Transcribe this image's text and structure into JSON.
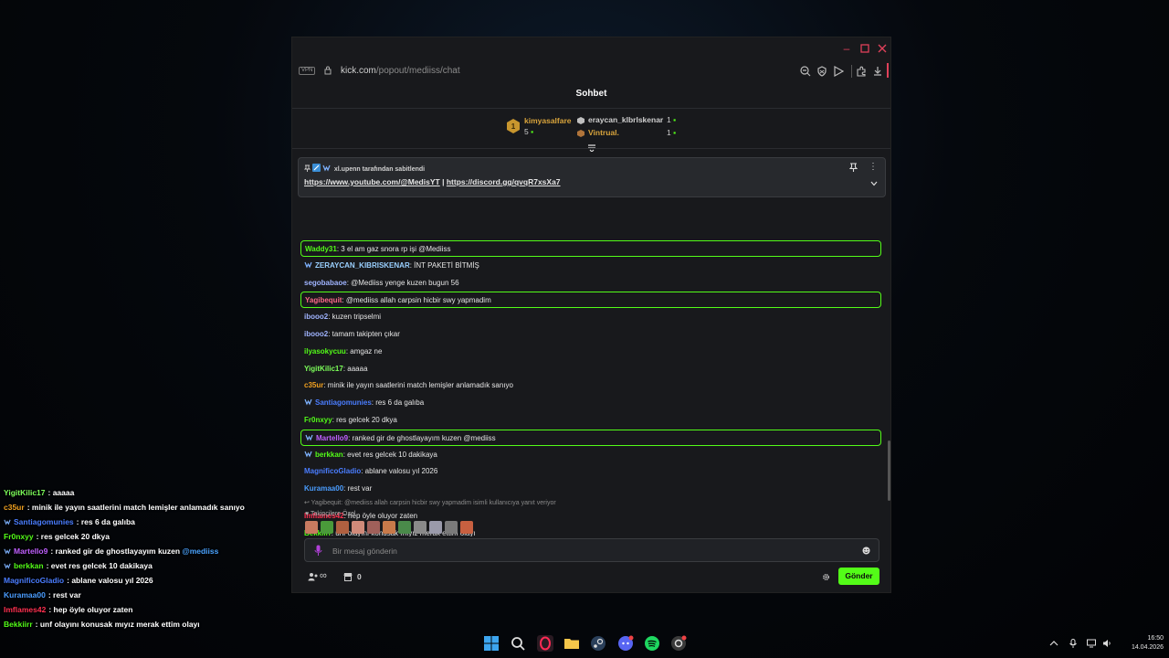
{
  "overlay": {
    "lines": [
      {
        "user": "YigitKilic17",
        "user_color": "#7dff5a",
        "badge": false,
        "text": ": aaaaa"
      },
      {
        "user": "c35ur",
        "user_color": "#f0a020",
        "badge": false,
        "text": ": minik ile yayın saatlerini match lemişler anlamadık sanıyo"
      },
      {
        "user": "Santiagomunies",
        "user_color": "#4a7dff",
        "badge": true,
        "text": ": res 6 da galıba"
      },
      {
        "user": "Fr0nxyy",
        "user_color": "#53fc18",
        "badge": false,
        "text": ": res gelcek 20 dkya"
      },
      {
        "user": "Martello9",
        "user_color": "#c060ff",
        "badge": true,
        "text": ": ranked gir de ghostlayayım kuzen ",
        "mention": "@mediiss"
      },
      {
        "user": "berkkan",
        "user_color": "#53fc18",
        "badge": true,
        "text": ": evet res gelcek 10 dakikaya"
      },
      {
        "user": "MagnificoGladio",
        "user_color": "#4a7dff",
        "badge": false,
        "text": ": ablane valosu yıl 2026"
      },
      {
        "user": "Kuramaa00",
        "user_color": "#4a9dff",
        "badge": false,
        "text": ": rest var"
      },
      {
        "user": "Imflames42",
        "user_color": "#ff3050",
        "badge": false,
        "text": ": hep öyle oluyor zaten"
      },
      {
        "user": "Bekkiirr",
        "user_color": "#53fc18",
        "badge": false,
        "text": ": unf olayını konusak mıyız merak ettim olayı"
      }
    ]
  },
  "browser": {
    "vpn_label": "VPN",
    "url_domain": "kick.com",
    "url_path": "/popout/mediiss/chat"
  },
  "chat": {
    "title": "Sohbet",
    "leaderboard": {
      "first": {
        "user": "kimyasalfare",
        "count": "5",
        "rank": "1"
      },
      "second": {
        "user": "eraycan_klbrlskenar",
        "count": "1"
      },
      "third": {
        "user": "Vintrual.",
        "count": "1"
      }
    },
    "pinned": {
      "header": "xl.upenn tarafından sabitlendi",
      "link1": "https://www.youtube.com/@MedisYT",
      "separator": "|",
      "link2": "https://discord.gg/qvqR7xsXa7"
    },
    "messages": [
      {
        "user": "Waddy31",
        "color": "#53fc18",
        "text": ": 3 el am gaz snora rp işi @Mediiss",
        "highlight": true,
        "badge": false
      },
      {
        "user": "ZERAYCAN_KIBRISKENAR",
        "color": "#9ad0ff",
        "text": ": İNT PAKETİ BİTMİŞ",
        "highlight": false,
        "badge": true
      },
      {
        "user": "segobabaoe",
        "color": "#a0b4ff",
        "text": ": @Mediiss yenge kuzen bugun 56",
        "highlight": false,
        "badge": false
      },
      {
        "user": "Yagibequit",
        "color": "#ff6a8a",
        "text": ": @mediiss allah carpsin hicbir swy yapmadim",
        "highlight": true,
        "badge": false
      },
      {
        "user": "ibooo2",
        "color": "#a0b4ff",
        "text": ": kuzen tripselmi",
        "highlight": false,
        "badge": false
      },
      {
        "user": "ibooo2",
        "color": "#a0b4ff",
        "text": ": tamam takipten çıkar",
        "highlight": false,
        "badge": false
      },
      {
        "user": "ilyasokycuu",
        "color": "#53fc18",
        "text": ": amgaz ne",
        "highlight": false,
        "badge": false
      },
      {
        "user": "YigitKilic17",
        "color": "#7dff5a",
        "text": ": aaaaa",
        "highlight": false,
        "badge": false
      },
      {
        "user": "c35ur",
        "color": "#f0a020",
        "text": ": minik ile yayın saatlerini match lemişler anlamadık sanıyo",
        "highlight": false,
        "badge": false
      },
      {
        "user": "Santiagomunies",
        "color": "#4a7dff",
        "text": ": res 6 da galıba",
        "highlight": false,
        "badge": true
      },
      {
        "user": "Fr0nxyy",
        "color": "#53fc18",
        "text": ": res gelcek 20 dkya",
        "highlight": false,
        "badge": false
      },
      {
        "user": "Martello9",
        "color": "#c060ff",
        "text": ": ranked gir de ghostlayayım kuzen @mediiss",
        "highlight": true,
        "badge": true
      },
      {
        "user": "berkkan",
        "color": "#53fc18",
        "text": ": evet res gelcek 10 dakikaya",
        "highlight": false,
        "badge": true
      },
      {
        "user": "MagnificoGladio",
        "color": "#4a7dff",
        "text": ": ablane valosu yıl 2026",
        "highlight": false,
        "badge": false
      },
      {
        "user": "Kuramaa00",
        "color": "#4a9dff",
        "text": ": rest var",
        "highlight": false,
        "badge": false
      },
      {
        "user": "Imflames42",
        "color": "#ff3050",
        "text": ": hep öyle oluyor zaten",
        "highlight": false,
        "badge": false,
        "reply": "Yagibequit: @mediiss allah carpsin hicbir swy yapmadim isimli kullanıcıya yanıt veriyor"
      },
      {
        "user": "Bekkiirr",
        "color": "#53fc18",
        "text": ": unf olayını konusak mıyız merak ettim olayı",
        "highlight": false,
        "badge": false
      }
    ],
    "subscriber_label": "Takipçilere Özel",
    "emote_colors": [
      "#c87a60",
      "#4a9a3a",
      "#b06040",
      "#d08a7a",
      "#a0605a",
      "#c87a4a",
      "#4a8a4a",
      "#8a8a8a",
      "#9a9aaa",
      "#7a7a7a",
      "#c86040"
    ],
    "input_placeholder": "Bir mesaj gönderin",
    "infinity": "∞",
    "store_count": "0",
    "send_label": "Gönder",
    "accent": "#53fc18"
  },
  "taskbar": {
    "time": "16:50",
    "date": "14.04.2026"
  }
}
